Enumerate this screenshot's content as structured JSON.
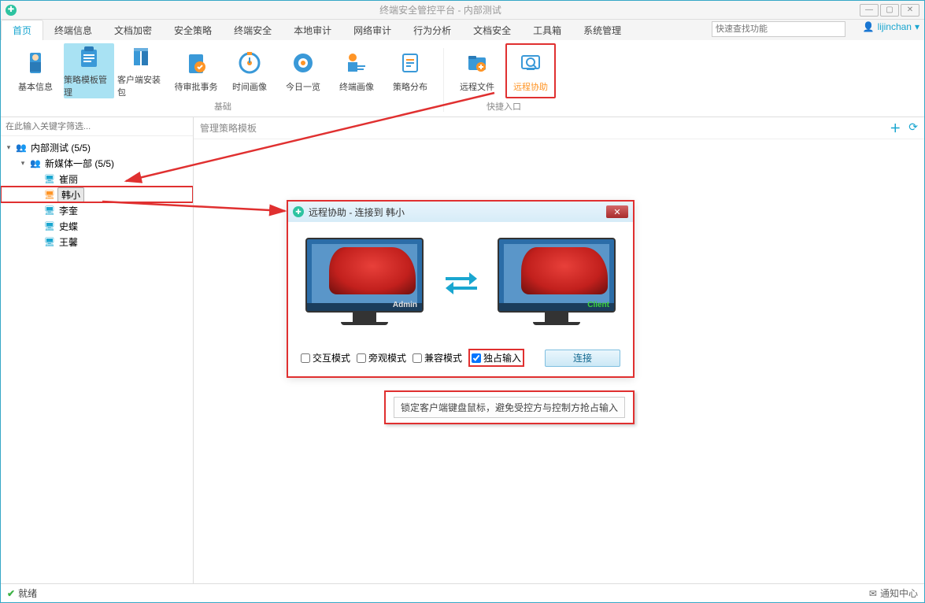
{
  "titlebar": {
    "title": "终端安全管控平台 - 内部测试"
  },
  "tabs": [
    "首页",
    "终端信息",
    "文档加密",
    "安全策略",
    "终端安全",
    "本地审计",
    "网络审计",
    "行为分析",
    "文档安全",
    "工具箱",
    "系统管理"
  ],
  "search_placeholder": "快速查找功能",
  "user": "lijinchan",
  "ribbon": {
    "group1_label": "基础",
    "group2_label": "快捷入口",
    "items1": [
      "基本信息",
      "策略模板管理",
      "客户端安装包",
      "待审批事务",
      "时间画像",
      "今日一览",
      "终端画像",
      "策略分布"
    ],
    "items2": [
      "远程文件",
      "远程协助"
    ]
  },
  "sidebar": {
    "search_placeholder": "在此输入关键字筛选...",
    "root": "内部测试 (5/5)",
    "group": "新媒体一部 (5/5)",
    "users": [
      "崔丽",
      "韩小",
      "李奎",
      "史蝶",
      "王馨"
    ]
  },
  "content": {
    "header": "管理策略模板"
  },
  "dialog": {
    "title": "远程协助 - 连接到 韩小",
    "opt_interact": "交互模式",
    "opt_watch": "旁观模式",
    "opt_compat": "兼容模式",
    "opt_exclusive": "独占输入",
    "connect": "连接",
    "admin_label": "Admin",
    "client_label": "Client"
  },
  "tooltip": "锁定客户端键盘鼠标，避免受控方与控制方抢占输入",
  "status": {
    "ready": "就绪",
    "notify": "通知中心"
  }
}
